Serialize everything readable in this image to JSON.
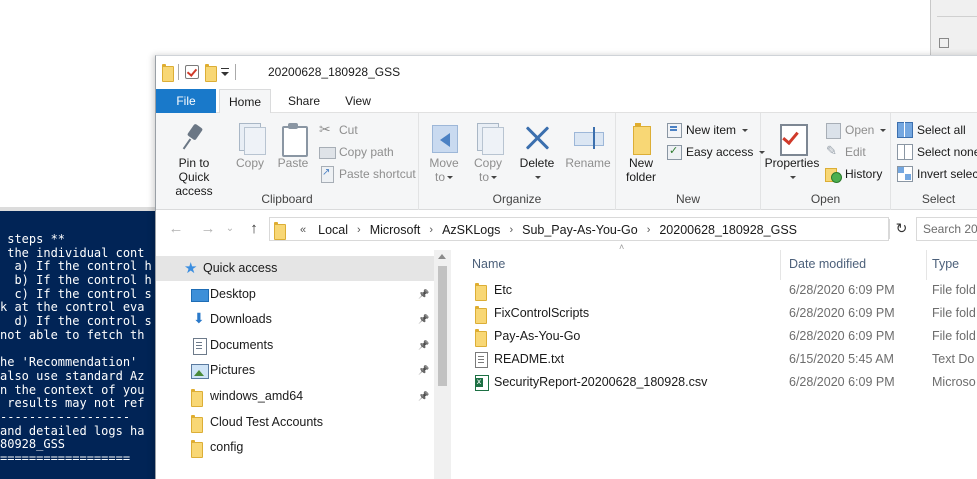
{
  "console": {
    "lines": [
      " steps **",
      " the individual cont",
      "  a) If the control h",
      "  b) If the control h",
      "  c) If the control s",
      "k at the control eva",
      "  d) If the control s",
      "not able to fetch th",
      "",
      "he 'Recommendation'",
      "also use standard Az",
      "n the context of you",
      " results may not ref",
      "------------------",
      "and detailed logs ha",
      "80928_GSS",
      "=================="
    ]
  },
  "window": {
    "title": "20200628_180928_GSS"
  },
  "tabs": {
    "file": "File",
    "home": "Home",
    "share": "Share",
    "view": "View"
  },
  "ribbon": {
    "clipboard": {
      "label": "Clipboard",
      "pin_line1": "Pin to Quick",
      "pin_line2": "access",
      "copy": "Copy",
      "paste": "Paste",
      "cut": "Cut",
      "copy_path": "Copy path",
      "paste_shortcut": "Paste shortcut"
    },
    "organize": {
      "label": "Organize",
      "move_line1": "Move",
      "move_line2": "to",
      "copy_line1": "Copy",
      "copy_line2": "to",
      "delete": "Delete",
      "rename": "Rename"
    },
    "new": {
      "label": "New",
      "folder_line1": "New",
      "folder_line2": "folder",
      "new_item": "New item",
      "easy_access": "Easy access"
    },
    "open": {
      "label": "Open",
      "properties": "Properties",
      "open": "Open",
      "edit": "Edit",
      "history": "History"
    },
    "select": {
      "label": "Select",
      "select_all": "Select all",
      "select_none": "Select none",
      "invert": "Invert select"
    }
  },
  "address": {
    "overflow": "«",
    "crumbs": [
      "Local",
      "Microsoft",
      "AzSKLogs",
      "Sub_Pay-As-You-Go",
      "20200628_180928_GSS"
    ],
    "search_placeholder": "Search 20"
  },
  "navpane": {
    "items": [
      {
        "label": "Quick access",
        "icon": "star-icon",
        "pinned": false,
        "selected": true
      },
      {
        "label": "Desktop",
        "icon": "desktop-icon",
        "pinned": true
      },
      {
        "label": "Downloads",
        "icon": "download-icon",
        "pinned": true
      },
      {
        "label": "Documents",
        "icon": "documents-icon",
        "pinned": true
      },
      {
        "label": "Pictures",
        "icon": "pictures-icon",
        "pinned": true
      },
      {
        "label": "windows_amd64",
        "icon": "folder-icon",
        "pinned": true
      },
      {
        "label": "Cloud Test Accounts",
        "icon": "folder-icon",
        "pinned": false
      },
      {
        "label": "config",
        "icon": "folder-icon",
        "pinned": false
      }
    ]
  },
  "filelist": {
    "columns": {
      "name": "Name",
      "date": "Date modified",
      "type": "Type"
    },
    "rows": [
      {
        "name": "Etc",
        "date": "6/28/2020 6:09 PM",
        "type": "File fold",
        "icon": "folder-icon"
      },
      {
        "name": "FixControlScripts",
        "date": "6/28/2020 6:09 PM",
        "type": "File fold",
        "icon": "folder-icon"
      },
      {
        "name": "Pay-As-You-Go",
        "date": "6/28/2020 6:09 PM",
        "type": "File fold",
        "icon": "folder-icon"
      },
      {
        "name": "README.txt",
        "date": "6/15/2020 5:45 AM",
        "type": "Text Do",
        "icon": "text-file-icon"
      },
      {
        "name": "SecurityReport-20200628_180928.csv",
        "date": "6/28/2020 6:09 PM",
        "type": "Microso",
        "icon": "excel-csv-icon"
      }
    ]
  },
  "colors": {
    "console_bg": "#012456",
    "file_tab": "#1979ca",
    "folder": "#f8d775",
    "selected_nav": "#e5e5e5"
  }
}
